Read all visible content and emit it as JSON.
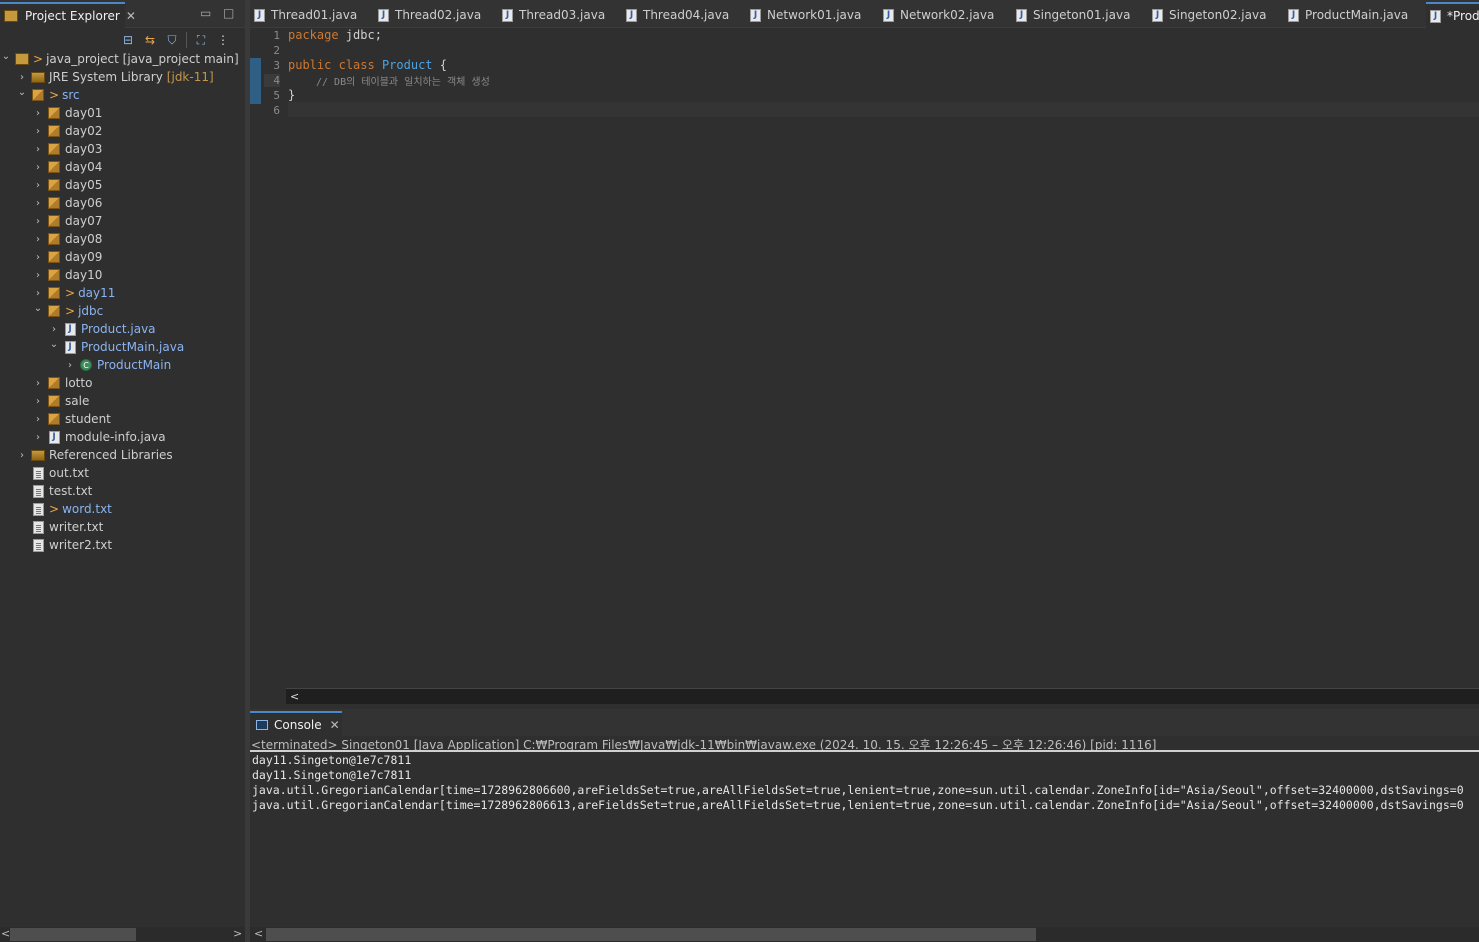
{
  "explorer": {
    "title": "Project Explorer",
    "close": "✕",
    "minimize": "▭",
    "maximize": "□",
    "tree": [
      {
        "label": "java_project [java_project main]",
        "expanded": true,
        "dirty": true,
        "icon": "project-icon"
      },
      {
        "label": "JRE System Library",
        "decoration": "[jdk-11]",
        "expanded": false,
        "icon": "library-icon"
      },
      {
        "label": "src",
        "expanded": true,
        "dirty": true,
        "blue": true,
        "icon": "source-folder-icon"
      },
      {
        "label": "day01",
        "icon": "package-icon"
      },
      {
        "label": "day02",
        "icon": "package-icon"
      },
      {
        "label": "day03",
        "icon": "package-icon"
      },
      {
        "label": "day04",
        "icon": "package-icon"
      },
      {
        "label": "day05",
        "icon": "package-icon"
      },
      {
        "label": "day06",
        "icon": "package-icon"
      },
      {
        "label": "day07",
        "icon": "package-icon"
      },
      {
        "label": "day08",
        "icon": "package-icon"
      },
      {
        "label": "day09",
        "icon": "package-icon"
      },
      {
        "label": "day10",
        "icon": "package-icon"
      },
      {
        "label": "day11",
        "dirty": true,
        "blue": true,
        "icon": "package-icon"
      },
      {
        "label": "jdbc",
        "dirty": true,
        "blue": true,
        "expanded": true,
        "icon": "package-icon"
      },
      {
        "label": "Product.java",
        "blue": true,
        "icon": "java-file-icon"
      },
      {
        "label": "ProductMain.java",
        "blue": true,
        "expanded": true,
        "icon": "java-file-icon"
      },
      {
        "label": "ProductMain",
        "blue": true,
        "icon": "class-icon"
      },
      {
        "label": "lotto",
        "icon": "package-icon"
      },
      {
        "label": "sale",
        "icon": "package-icon"
      },
      {
        "label": "student",
        "icon": "package-icon"
      },
      {
        "label": "module-info.java",
        "icon": "java-file-icon"
      },
      {
        "label": "Referenced Libraries",
        "icon": "library-icon"
      },
      {
        "label": "out.txt",
        "icon": "text-file-icon"
      },
      {
        "label": "test.txt",
        "icon": "text-file-icon"
      },
      {
        "label": "word.txt",
        "dirty": true,
        "blue": true,
        "icon": "text-file-icon"
      },
      {
        "label": "writer.txt",
        "icon": "text-file-icon"
      },
      {
        "label": "writer2.txt",
        "icon": "text-file-icon"
      }
    ]
  },
  "editor": {
    "tabs": [
      {
        "label": "Thread01.java"
      },
      {
        "label": "Thread02.java"
      },
      {
        "label": "Thread03.java"
      },
      {
        "label": "Thread04.java"
      },
      {
        "label": "Network01.java"
      },
      {
        "label": "Network02.java"
      },
      {
        "label": "Singeton01.java"
      },
      {
        "label": "Singeton02.java"
      },
      {
        "label": "ProductMain.java"
      },
      {
        "label": "*Prod",
        "active": true
      }
    ],
    "line_numbers": [
      "1",
      "2",
      "3",
      "4",
      "5",
      "6"
    ],
    "code": {
      "l1_kw": "package",
      "l1_rest": " jdbc;",
      "l3_kw1": "public",
      "l3_kw2": "class",
      "l3_cls": "Product",
      "l3_rest": " {",
      "l4_comment": "// DB의 테이블과 일치하는 객체 생성",
      "l5": "}"
    }
  },
  "console": {
    "title": "Console",
    "close": "✕",
    "terminated": "<terminated> Singeton01 [Java Application] C:₩Program Files₩Java₩jdk-11₩bin₩javaw.exe  (2024. 10. 15. 오후 12:26:45 – 오후 12:26:46) [pid: 1116]",
    "output": [
      "day11.Singeton@1e7c7811",
      "day11.Singeton@1e7c7811",
      "java.util.GregorianCalendar[time=1728962806600,areFieldsSet=true,areAllFieldsSet=true,lenient=true,zone=sun.util.calendar.ZoneInfo[id=\"Asia/Seoul\",offset=32400000,dstSavings=0",
      "java.util.GregorianCalendar[time=1728962806613,areFieldsSet=true,areAllFieldsSet=true,lenient=true,zone=sun.util.calendar.ZoneInfo[id=\"Asia/Seoul\",offset=32400000,dstSavings=0"
    ]
  },
  "glyphs": {
    "dirty": ">",
    "left": "<",
    "right": ">",
    "collapse_all": "⊟",
    "link": "⇆",
    "filter": "⛉",
    "view": "⛶",
    "more": "⋮"
  }
}
